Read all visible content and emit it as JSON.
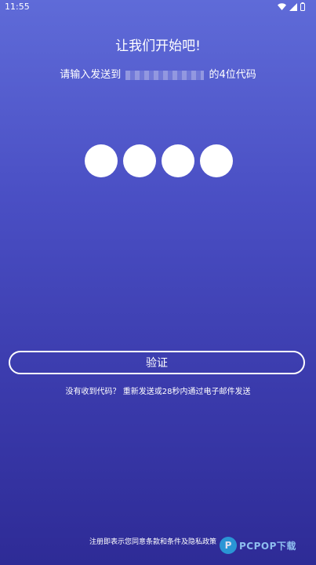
{
  "status_bar": {
    "time": "11:55"
  },
  "header": {
    "title": "让我们开始吧!",
    "subtitle_prefix": "请输入发送到",
    "subtitle_suffix": "的4位代码"
  },
  "code_input": {
    "digit_count": 4
  },
  "verify_button": {
    "label": "验证"
  },
  "resend": {
    "text": "没有收到代码？ 重新发送或28秒内通过电子邮件发送"
  },
  "terms": {
    "text": "注册即表示您同意条款和条件及隐私政策"
  },
  "watermark": {
    "text": "PCPOP下载"
  }
}
